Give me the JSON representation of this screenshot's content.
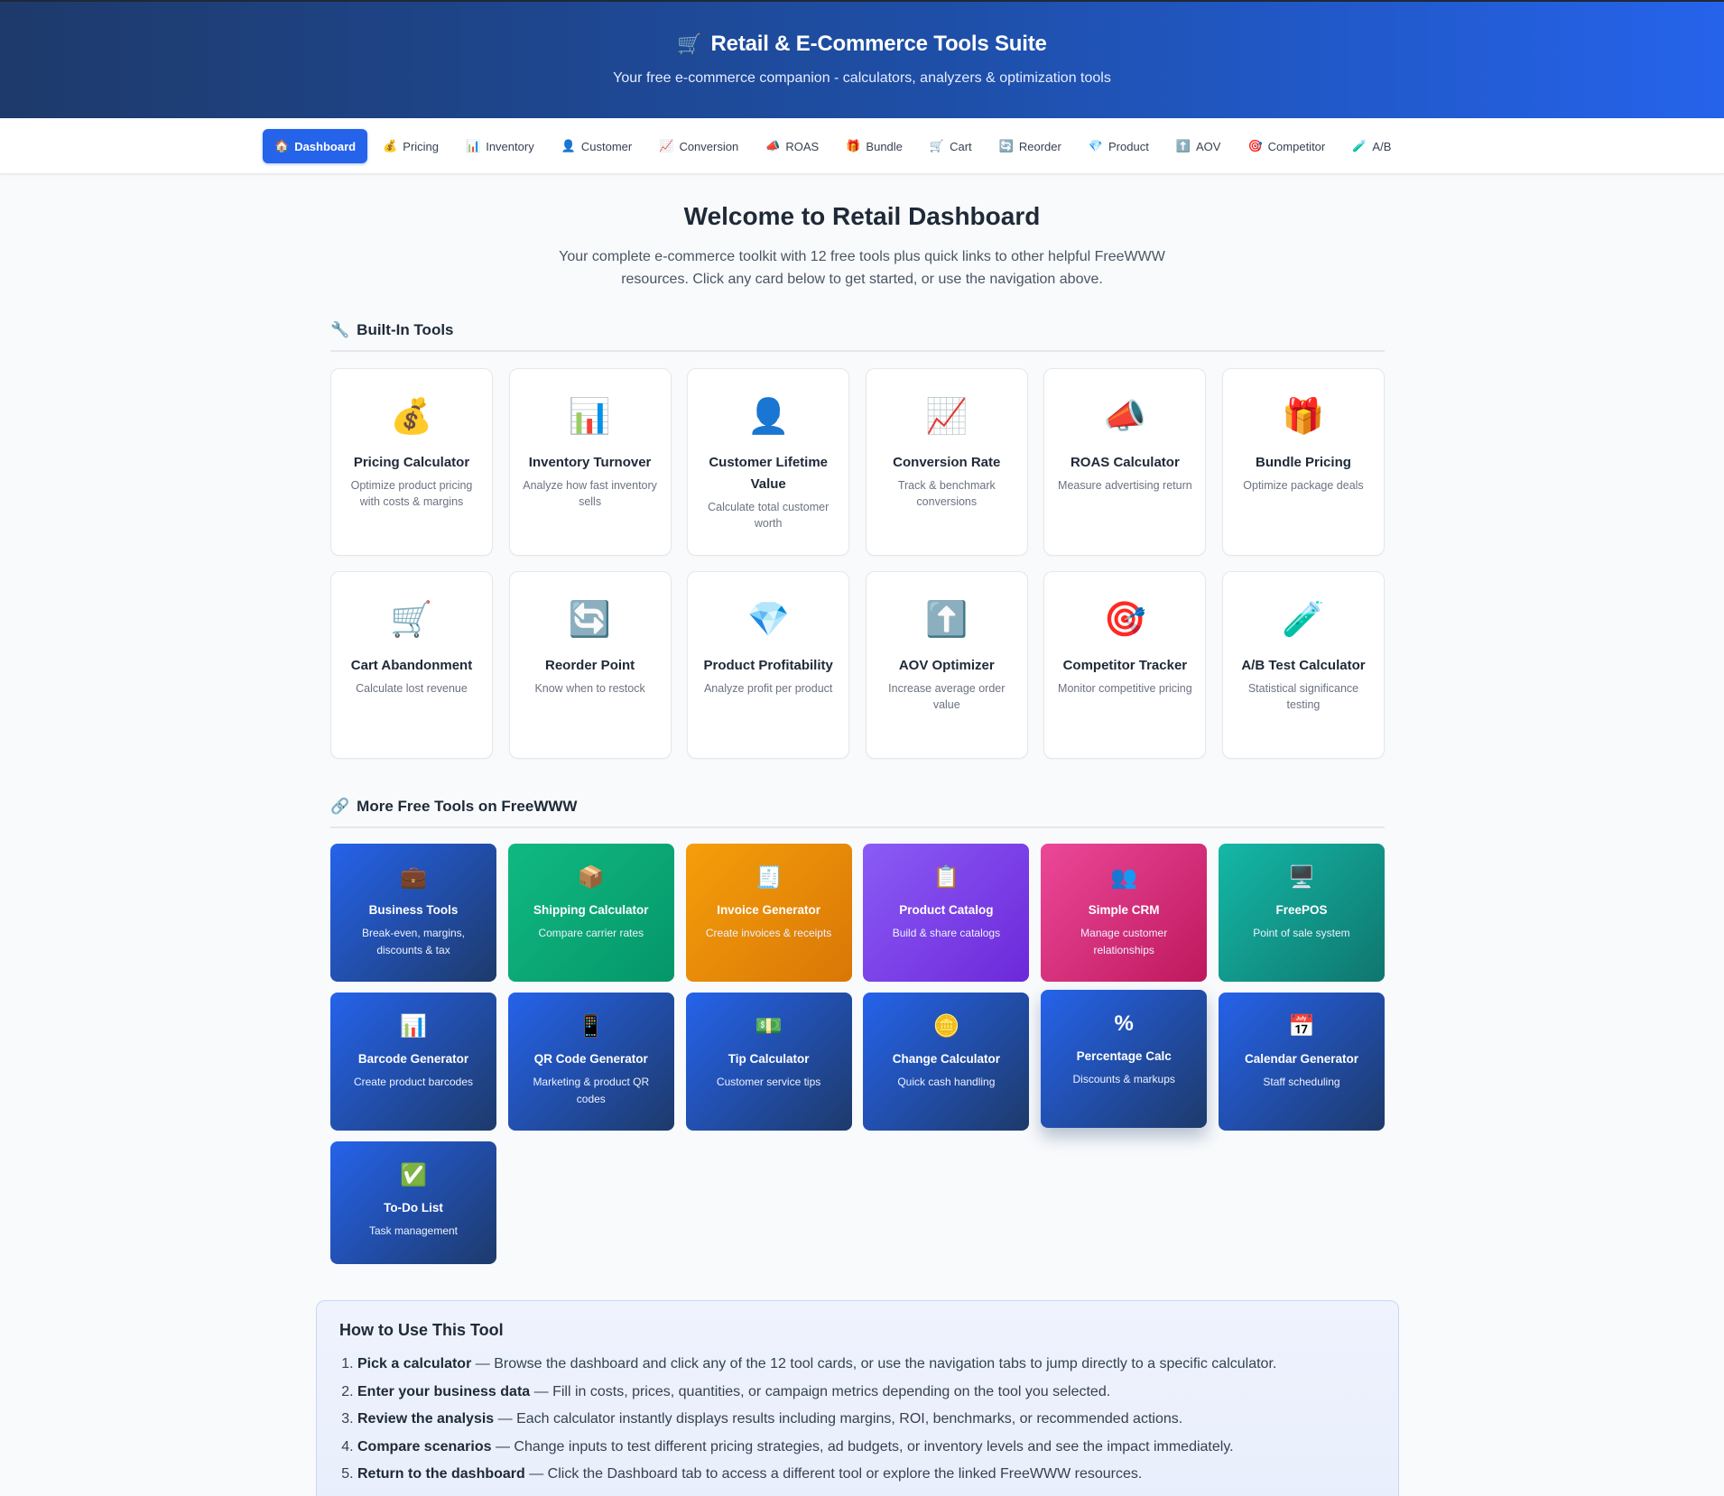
{
  "header": {
    "icon": "🛒",
    "title": "Retail & E-Commerce Tools Suite",
    "subtitle": "Your free e-commerce companion - calculators, analyzers & optimization tools"
  },
  "nav": [
    {
      "icon": "🏠",
      "label": "Dashboard",
      "active": true
    },
    {
      "icon": "💰",
      "label": "Pricing"
    },
    {
      "icon": "📊",
      "label": "Inventory"
    },
    {
      "icon": "👤",
      "label": "Customer"
    },
    {
      "icon": "📈",
      "label": "Conversion"
    },
    {
      "icon": "📣",
      "label": "ROAS"
    },
    {
      "icon": "🎁",
      "label": "Bundle"
    },
    {
      "icon": "🛒",
      "label": "Cart"
    },
    {
      "icon": "🔄",
      "label": "Reorder"
    },
    {
      "icon": "💎",
      "label": "Product"
    },
    {
      "icon": "⬆️",
      "label": "AOV"
    },
    {
      "icon": "🎯",
      "label": "Competitor"
    },
    {
      "icon": "🧪",
      "label": "A/B"
    }
  ],
  "main": {
    "title": "Welcome to Retail Dashboard",
    "intro": "Your complete e-commerce toolkit with 12 free tools plus quick links to other helpful FreeWWW resources. Click any card below to get started, or use the navigation above."
  },
  "builtin": {
    "icon": "🔧",
    "heading": "Built-In Tools",
    "tools": [
      {
        "icon": "💰",
        "title": "Pricing Calculator",
        "desc": "Optimize product pricing with costs & margins"
      },
      {
        "icon": "📊",
        "title": "Inventory Turnover",
        "desc": "Analyze how fast inventory sells"
      },
      {
        "icon": "👤",
        "title": "Customer Lifetime Value",
        "desc": "Calculate total customer worth"
      },
      {
        "icon": "📈",
        "title": "Conversion Rate",
        "desc": "Track & benchmark conversions"
      },
      {
        "icon": "📣",
        "title": "ROAS Calculator",
        "desc": "Measure advertising return"
      },
      {
        "icon": "🎁",
        "title": "Bundle Pricing",
        "desc": "Optimize package deals"
      },
      {
        "icon": "🛒",
        "title": "Cart Abandonment",
        "desc": "Calculate lost revenue"
      },
      {
        "icon": "🔄",
        "title": "Reorder Point",
        "desc": "Know when to restock"
      },
      {
        "icon": "💎",
        "title": "Product Profitability",
        "desc": "Analyze profit per product"
      },
      {
        "icon": "⬆️",
        "title": "AOV Optimizer",
        "desc": "Increase average order value"
      },
      {
        "icon": "🎯",
        "title": "Competitor Tracker",
        "desc": "Monitor competitive pricing"
      },
      {
        "icon": "🧪",
        "title": "A/B Test Calculator",
        "desc": "Statistical significance testing"
      }
    ]
  },
  "more": {
    "icon": "🔗",
    "heading": "More Free Tools on FreeWWW",
    "tools": [
      {
        "icon": "💼",
        "title": "Business Tools",
        "desc": "Break-even, margins, discounts & tax",
        "gradient": "blue"
      },
      {
        "icon": "📦",
        "title": "Shipping Calculator",
        "desc": "Compare carrier rates",
        "gradient": "green"
      },
      {
        "icon": "🧾",
        "title": "Invoice Generator",
        "desc": "Create invoices & receipts",
        "gradient": "orange"
      },
      {
        "icon": "📋",
        "title": "Product Catalog",
        "desc": "Build & share catalogs",
        "gradient": "purple"
      },
      {
        "icon": "👥",
        "title": "Simple CRM",
        "desc": "Manage customer relationships",
        "gradient": "pink"
      },
      {
        "icon": "🖥️",
        "title": "FreePOS",
        "desc": "Point of sale system",
        "gradient": "teal"
      },
      {
        "icon": "📊",
        "title": "Barcode Generator",
        "desc": "Create product barcodes",
        "gradient": "blue"
      },
      {
        "icon": "📱",
        "title": "QR Code Generator",
        "desc": "Marketing & product QR codes",
        "gradient": "blue"
      },
      {
        "icon": "💵",
        "title": "Tip Calculator",
        "desc": "Customer service tips",
        "gradient": "blue"
      },
      {
        "icon": "🪙",
        "title": "Change Calculator",
        "desc": "Quick cash handling",
        "gradient": "blue"
      },
      {
        "icon": "%",
        "title": "Percentage Calc",
        "desc": "Discounts & markups",
        "gradient": "blue"
      },
      {
        "icon": "📅",
        "title": "Calendar Generator",
        "desc": "Staff scheduling",
        "gradient": "blue"
      },
      {
        "icon": "✅",
        "title": "To-Do List",
        "desc": "Task management",
        "gradient": "blue"
      }
    ]
  },
  "howto": {
    "title": "How to Use This Tool",
    "steps": [
      {
        "bold": "Pick a calculator",
        "text": " — Browse the dashboard and click any of the 12 tool cards, or use the navigation tabs to jump directly to a specific calculator."
      },
      {
        "bold": "Enter your business data",
        "text": " — Fill in costs, prices, quantities, or campaign metrics depending on the tool you selected."
      },
      {
        "bold": "Review the analysis",
        "text": " — Each calculator instantly displays results including margins, ROI, benchmarks, or recommended actions."
      },
      {
        "bold": "Compare scenarios",
        "text": " — Change inputs to test different pricing strategies, ad budgets, or inventory levels and see the impact immediately."
      },
      {
        "bold": "Return to the dashboard",
        "text": " — Click the Dashboard tab to access a different tool or explore the linked FreeWWW resources."
      }
    ]
  }
}
